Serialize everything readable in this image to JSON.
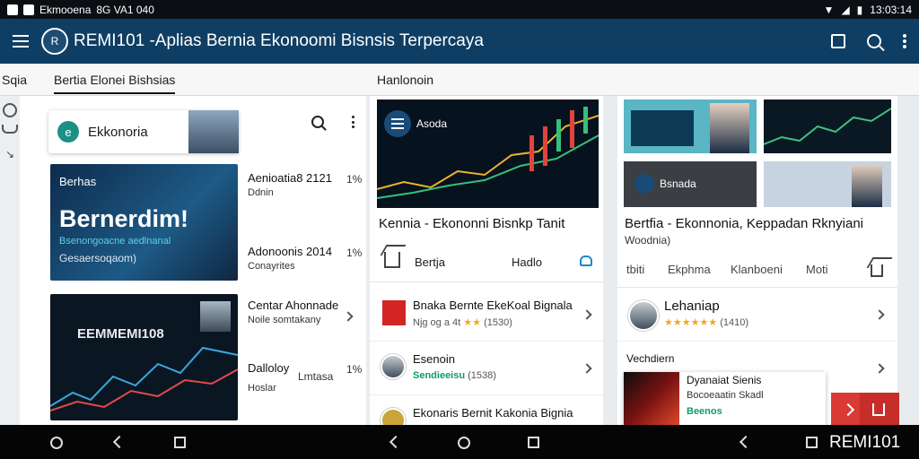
{
  "status_bar": {
    "left_text": "Ekmooena",
    "mid_text": "8G VA1 040",
    "time": "13:03:14"
  },
  "app_bar": {
    "logo_text": "R",
    "title": "REMI101 -Aplias Bernia Ekonoomi Bisnsis Terpercaya"
  },
  "tabs": {
    "left_stub": "Sqia",
    "active": "Bertia Elonei Bishsias",
    "second": "Hanlonoin"
  },
  "panel1": {
    "search_card_badge": "e",
    "search_card_label": "Ekkonoria",
    "thumb_a": {
      "tag": "Berhas",
      "headline": "Bernerdim!",
      "sub1": "Bsenongoacne aedlnanal",
      "sub2": "Gesaersoqaom)"
    },
    "thumb_b": {
      "headline": "EEMMEMI108"
    },
    "articles": [
      {
        "title": "Aenioatia8 2121",
        "pct": "1%",
        "sub": "Ddnin"
      },
      {
        "title": "Adonoonis 2014",
        "pct": "1%",
        "sub": "Conayrites"
      },
      {
        "title": "Centar Ahonnade",
        "pct": "",
        "sub": "Noile somtakany"
      },
      {
        "title": "Dalloloy",
        "pct": "1%",
        "sub": "Hoslar",
        "extra": "Lmtasa"
      }
    ]
  },
  "panel2": {
    "hero_label": "Asoda",
    "title": "Kennia - Ekononni Bisnkp Tanit",
    "tag_left": "Bertja",
    "tag_right": "Hadlo",
    "rows": [
      {
        "head": "Bnaka Bernte EkeKoal Bignala",
        "sub": "Njg og a 4t",
        "stars": "★★",
        "count": "(1530)"
      },
      {
        "head": "Esenoin",
        "sub": "Sendieeisu",
        "count": "(1538)"
      },
      {
        "head": "Ekonaris Bernit Kakonia Bignia",
        "sub": ""
      }
    ]
  },
  "panel3": {
    "title": "Bertfia - Ekonnonia, Keppadan Rknyiani",
    "subtitle": "Woodnia)",
    "mid_tile_label": "Bsnada",
    "tags": [
      "tbiti",
      "Ekphma",
      "Klanboeni",
      "Moti"
    ],
    "rows": [
      {
        "head": "Lehaniap",
        "stars": "★★★★★★",
        "count": "(1410)"
      },
      {
        "head": "Vechdiern"
      }
    ]
  },
  "promo": {
    "head": "Dyanaiat",
    "head2": "Sienis",
    "sub": "Bocoeaatin Skadl",
    "tag": "Beenos"
  },
  "nav": {
    "brand": "REMI101"
  },
  "colors": {
    "app_bar": "#0e3e63",
    "accent_red": "#d93a33",
    "star": "#f2a81d"
  }
}
